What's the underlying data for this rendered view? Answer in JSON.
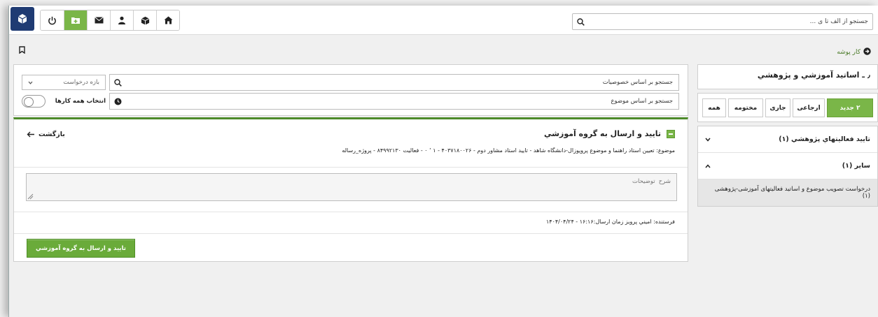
{
  "search": {
    "placeholder": "جستجو از الف تا ی ..."
  },
  "breadcrumb": {
    "label": "کار پوشه"
  },
  "right_panel": {
    "title": "٫ ـ اساتید آموزشي و پژوهشي",
    "tabs": [
      {
        "label": "۲ جدید",
        "active": true
      },
      {
        "label": "ارجاعی",
        "active": false
      },
      {
        "label": "جاری",
        "active": false
      },
      {
        "label": "مختومه",
        "active": false
      },
      {
        "label": "همه",
        "active": false
      }
    ],
    "groups": [
      {
        "label": "تایید فعالیتهاي پژوهشي (۱)",
        "expanded": false
      },
      {
        "label": "سایر (۱)",
        "expanded": true,
        "items": [
          "درخواست تصویب موضوع و اساتید فعالیتهای آموزشی-پژوهشی (۱)"
        ]
      }
    ]
  },
  "filters": {
    "props_placeholder": "جستجو بر اساس خصوصیات",
    "topic_placeholder": "جستجو بر اساس موضوع",
    "range_label": "بازه درخواست",
    "select_all_label": "انتخاب همه کارها"
  },
  "detail": {
    "title": "تایید و ارسال به گروه آموزشي",
    "back_label": "بازگشت",
    "subject": "موضوع: تعیین استاد راهنما و موضوع پروپوزال-دانشگاه شاهد - تایید استاد مشاور دوم - ۴۰۳۷۱۸۰۰۲۶ - ۱   ٬ ٠ - فعالیت ۸۴۹۹۲۱۳۰ - پروژه_رساله",
    "description_placeholder": "شرح توضیحات",
    "sender": "فرستنده: اميني پرويز   زمان ارسال:۱۶:۱۶ - ۱۴۰۴/۰۴/۲۴",
    "submit_label": "تایید و ارسال به گروه آموزشي"
  },
  "colors": {
    "accent": "#7ab648",
    "brand": "#1f3b73",
    "header_line": "#4d8b2a"
  }
}
